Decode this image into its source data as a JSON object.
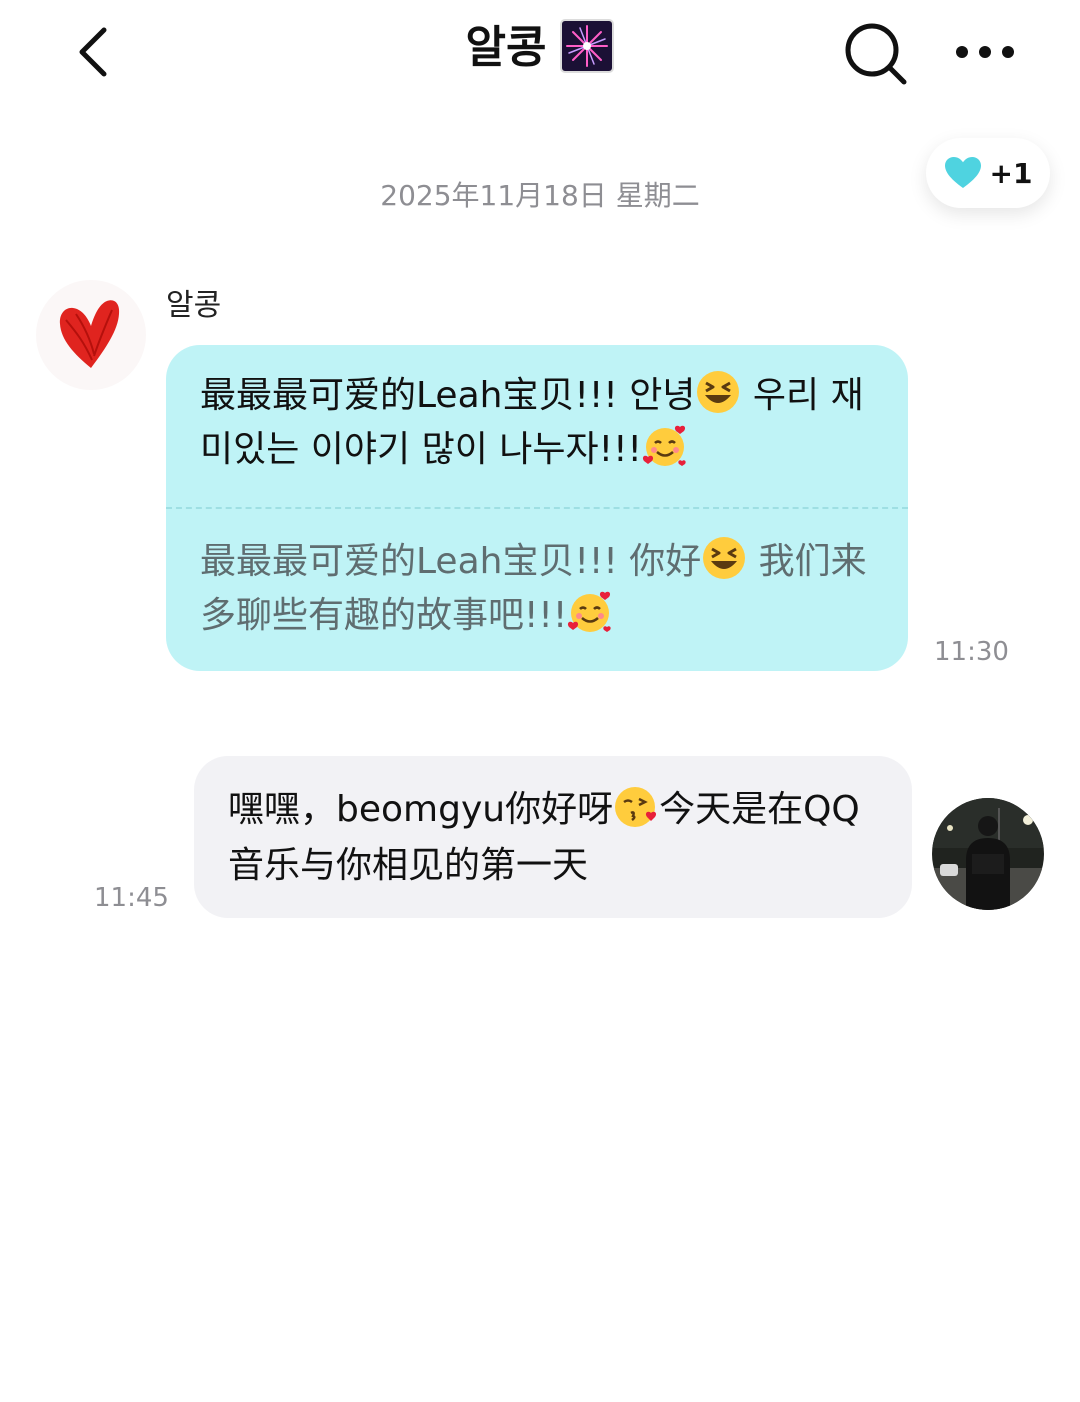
{
  "header": {
    "title": "알콩",
    "back_icon": "chevron-left-icon",
    "title_icon": "fireworks-icon",
    "search_icon": "search-icon",
    "more_icon": "more-horizontal-icon"
  },
  "like_badge": {
    "icon": "heart-icon",
    "count": "+1",
    "color": "#4fd3e0"
  },
  "date_separator": "2025年11月18日 星期二",
  "messages": [
    {
      "direction": "incoming",
      "sender": "알콩",
      "original_parts": [
        "最最最可爱的Leah宝贝!!! 안녕",
        " 우리 재미있는 이야기 많이 나누자!!!"
      ],
      "translation_parts": [
        "最最最可爱的Leah宝贝!!! 你好",
        " 我们来多聊些有趣的故事吧!!!"
      ],
      "time": "11:30",
      "bubble_color": "#bff3f6"
    },
    {
      "direction": "outgoing",
      "text_parts": [
        "嘿嘿，beomgyu你好呀",
        "今天是在QQ音乐与你相见的第一天"
      ],
      "time": "11:45",
      "bubble_color": "#f2f2f5"
    }
  ]
}
